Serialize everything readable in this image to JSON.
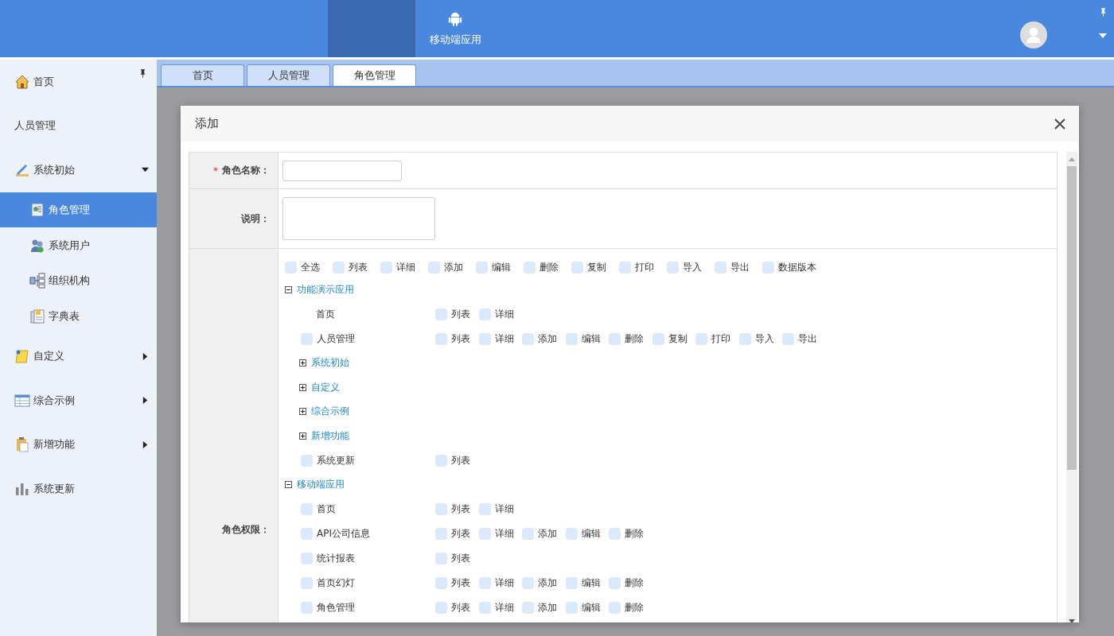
{
  "header": {
    "nav": [
      {
        "label": "移动端应用",
        "selected": false
      }
    ]
  },
  "sidebar": {
    "items": [
      {
        "label": "首页",
        "selected": false
      },
      {
        "label": "人员管理",
        "selected": false
      },
      {
        "label": "系统初始",
        "selected": false,
        "expanded": true,
        "children": [
          {
            "label": "角色管理",
            "selected": true
          },
          {
            "label": "系统用户",
            "selected": false
          },
          {
            "label": "组织机构",
            "selected": false
          },
          {
            "label": "字典表",
            "selected": false
          }
        ]
      },
      {
        "label": "自定义",
        "selected": false,
        "expanded": false
      },
      {
        "label": "综合示例",
        "selected": false,
        "expanded": false
      },
      {
        "label": "新增功能",
        "selected": false,
        "expanded": false
      },
      {
        "label": "系统更新",
        "selected": false
      }
    ]
  },
  "tabs": [
    {
      "label": "首页",
      "selected": false
    },
    {
      "label": "人员管理",
      "selected": false
    },
    {
      "label": "角色管理",
      "selected": true
    }
  ],
  "dialog": {
    "title": "添加",
    "fields": [
      {
        "label": "角色名称：",
        "kind": "input",
        "required_mark": "*"
      },
      {
        "label": "说明：",
        "kind": "textarea"
      }
    ],
    "permissions": {
      "label": "角色权限：",
      "select_row": [
        {
          "label": "全选",
          "checked": false
        },
        {
          "label": "列表",
          "checked": false
        },
        {
          "label": "详细",
          "checked": false
        },
        {
          "label": "添加",
          "checked": false
        },
        {
          "label": "编辑",
          "checked": false
        },
        {
          "label": "删除",
          "checked": false
        },
        {
          "label": "复制",
          "checked": false
        },
        {
          "label": "打印",
          "checked": false
        },
        {
          "label": "导入",
          "checked": false
        },
        {
          "label": "导出",
          "checked": false
        },
        {
          "label": "数据版本",
          "checked": false
        }
      ],
      "tree": [
        {
          "kind": "group",
          "label": "功能演示应用",
          "expanded": true,
          "children": [
            {
              "kind": "page",
              "label": "首页",
              "perms": [
                {
                  "label": "列表",
                  "checked": false
                },
                {
                  "label": "详细",
                  "checked": false
                }
              ]
            },
            {
              "kind": "module",
              "label": "人员管理",
              "checked": false,
              "perms": [
                {
                  "label": "列表",
                  "checked": false
                },
                {
                  "label": "详细",
                  "checked": false
                },
                {
                  "label": "添加",
                  "checked": false
                },
                {
                  "label": "编辑",
                  "checked": false
                },
                {
                  "label": "删除",
                  "checked": false
                },
                {
                  "label": "复制",
                  "checked": false
                },
                {
                  "label": "打印",
                  "checked": false
                },
                {
                  "label": "导入",
                  "checked": false
                },
                {
                  "label": "导出",
                  "checked": false
                }
              ]
            },
            {
              "kind": "group",
              "label": "系统初始",
              "expanded": false
            },
            {
              "kind": "group",
              "label": "自定义",
              "expanded": false
            },
            {
              "kind": "group",
              "label": "综合示例",
              "expanded": false
            },
            {
              "kind": "group",
              "label": "新增功能",
              "expanded": false
            },
            {
              "kind": "module",
              "label": "系统更新",
              "checked": false,
              "perms": [
                {
                  "label": "列表",
                  "checked": false
                }
              ]
            }
          ]
        },
        {
          "kind": "group",
          "label": "移动端应用",
          "expanded": true,
          "children": [
            {
              "kind": "module",
              "label": "首页",
              "checked": false,
              "perms": [
                {
                  "label": "列表",
                  "checked": false
                },
                {
                  "label": "详细",
                  "checked": false
                }
              ]
            },
            {
              "kind": "module",
              "label": "API公司信息",
              "checked": false,
              "perms": [
                {
                  "label": "列表",
                  "checked": false
                },
                {
                  "label": "详细",
                  "checked": false
                },
                {
                  "label": "添加",
                  "checked": false
                },
                {
                  "label": "编辑",
                  "checked": false
                },
                {
                  "label": "删除",
                  "checked": false
                }
              ]
            },
            {
              "kind": "module",
              "label": "统计报表",
              "checked": false,
              "perms": [
                {
                  "label": "列表",
                  "checked": false
                }
              ]
            },
            {
              "kind": "module",
              "label": "首页幻灯",
              "checked": false,
              "perms": [
                {
                  "label": "列表",
                  "checked": false
                },
                {
                  "label": "详细",
                  "checked": false
                },
                {
                  "label": "添加",
                  "checked": false
                },
                {
                  "label": "编辑",
                  "checked": false
                },
                {
                  "label": "删除",
                  "checked": false
                }
              ]
            },
            {
              "kind": "module",
              "label": "角色管理",
              "checked": false,
              "perms": [
                {
                  "label": "列表",
                  "checked": false
                },
                {
                  "label": "详细",
                  "checked": false
                },
                {
                  "label": "添加",
                  "checked": false
                },
                {
                  "label": "编辑",
                  "checked": false
                },
                {
                  "label": "删除",
                  "checked": false
                }
              ]
            }
          ]
        }
      ]
    }
  }
}
